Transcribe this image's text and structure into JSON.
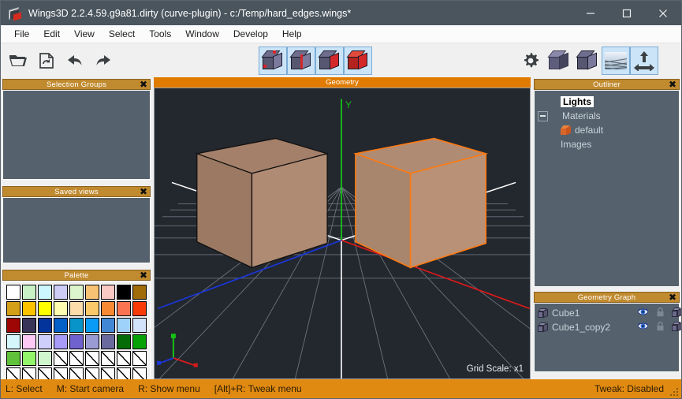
{
  "window": {
    "title": "Wings3D 2.2.4.59.g9a81.dirty (curve-plugin) - c:/Temp/hard_edges.wings*",
    "minimize": "minimize-icon",
    "maximize": "maximize-icon",
    "close": "close-icon"
  },
  "menubar": {
    "items": [
      "File",
      "Edit",
      "View",
      "Select",
      "Tools",
      "Window",
      "Develop",
      "Help"
    ]
  },
  "toolbar": {
    "left": [
      {
        "name": "open-file",
        "icon": "folder-open-icon"
      },
      {
        "name": "save-as",
        "icon": "save-as-icon"
      },
      {
        "name": "undo",
        "icon": "undo-arrow-icon"
      },
      {
        "name": "redo",
        "icon": "redo-arrow-icon"
      }
    ],
    "select_modes": [
      {
        "name": "vertex-mode",
        "icon": "cube-vertex-icon",
        "active": true
      },
      {
        "name": "edge-mode",
        "icon": "cube-edge-icon",
        "active": true
      },
      {
        "name": "face-mode",
        "icon": "cube-face-icon",
        "active": true
      },
      {
        "name": "body-mode",
        "icon": "cube-body-icon",
        "active": true
      }
    ],
    "right": [
      {
        "name": "preferences",
        "icon": "gear-icon",
        "active": false
      },
      {
        "name": "smooth-shade",
        "icon": "cube-smooth-icon",
        "active": false
      },
      {
        "name": "wireframe",
        "icon": "cube-wire-icon",
        "active": false
      },
      {
        "name": "show-ground-plane",
        "icon": "ground-grid-icon",
        "active": true
      },
      {
        "name": "show-axes",
        "icon": "axes-icon",
        "active": true
      }
    ]
  },
  "panels": {
    "selection_groups": {
      "title": "Selection Groups",
      "close": "✖",
      "items": []
    },
    "saved_views": {
      "title": "Saved views",
      "close": "✖",
      "items": []
    },
    "palette": {
      "title": "Palette",
      "close": "✖",
      "rows": [
        [
          "#ffffff",
          "#c8f2c6",
          "#ccf7ff",
          "#ccccf7",
          "#ddf5cc",
          "#f7c274",
          "#fbc9c4",
          "#000000",
          "#a06c0a"
        ],
        [
          "#d4a017",
          "#fcc200",
          "#ffff00",
          "#fdfcb0",
          "#fbdcaa",
          "#f9c96a",
          "#f98a33",
          "#fb7452",
          "#f93b08"
        ],
        [
          "#9e0606",
          "#383559",
          "#03349c",
          "#0560c7",
          "#0894c9",
          "#0a9bf7",
          "#4287d4",
          "#9ed2fb",
          "#d3e2fb"
        ],
        [
          "#d5f7fb",
          "#fbc9f3",
          "#cfcffb",
          "#a79bf7",
          "#6f62cf",
          "#9b9bd4",
          "#6a6a9e",
          "#046b06",
          "#06a206"
        ],
        [
          "#60c23a",
          "#93f56a",
          "#d0f7ce",
          "EMPTY",
          "EMPTY",
          "EMPTY",
          "EMPTY",
          "EMPTY",
          "EMPTY"
        ],
        [
          "EMPTY",
          "EMPTY",
          "EMPTY",
          "EMPTY",
          "EMPTY",
          "EMPTY",
          "EMPTY",
          "EMPTY",
          "EMPTY"
        ]
      ]
    },
    "outliner": {
      "title": "Outliner",
      "close": "✖",
      "items": [
        {
          "label": "Lights",
          "highlighted": true,
          "indent": 1,
          "icon": null,
          "expander": false
        },
        {
          "label": "Materials",
          "highlighted": false,
          "indent": 1,
          "icon": null,
          "expander": true
        },
        {
          "label": "default",
          "highlighted": false,
          "indent": 2,
          "icon": "material-cube-icon",
          "expander": false
        },
        {
          "label": "Images",
          "highlighted": false,
          "indent": 1,
          "icon": null,
          "expander": false
        }
      ]
    },
    "geometry_graph": {
      "title": "Geometry Graph",
      "close": "✖",
      "columns": [
        "object",
        "visibility",
        "lock",
        "wireframe"
      ],
      "rows": [
        {
          "name": "Cube1",
          "icon": "object-cube-icon",
          "eye": "eye-icon",
          "lock": "padlock-icon",
          "wire": "wireframe-cube-icon"
        },
        {
          "name": "Cube1_copy2",
          "icon": "object-cube-icon",
          "eye": "eye-icon",
          "lock": "padlock-icon",
          "wire": "wireframe-cube-icon"
        }
      ]
    }
  },
  "viewport": {
    "title": "Geometry",
    "grid_scale": "Grid Scale: x1",
    "axis_labels": {
      "y": "Y"
    },
    "colors": {
      "background": "#23272e",
      "grid": "#7d858e",
      "axis_x": "#d81a1a",
      "axis_y": "#16c216",
      "axis_z": "#1a37d8",
      "axis_negative": "#ffffff",
      "object_fill": "#a8846a",
      "selected_edge": "#ff7a11"
    },
    "objects": [
      {
        "name": "Cube1",
        "selected": false
      },
      {
        "name": "Cube1_copy2",
        "selected": true
      }
    ]
  },
  "statusbar": {
    "hints": [
      "L: Select",
      "M: Start camera",
      "R: Show menu",
      "[Alt]+R: Tweak menu"
    ],
    "tweak": "Tweak: Disabled"
  }
}
